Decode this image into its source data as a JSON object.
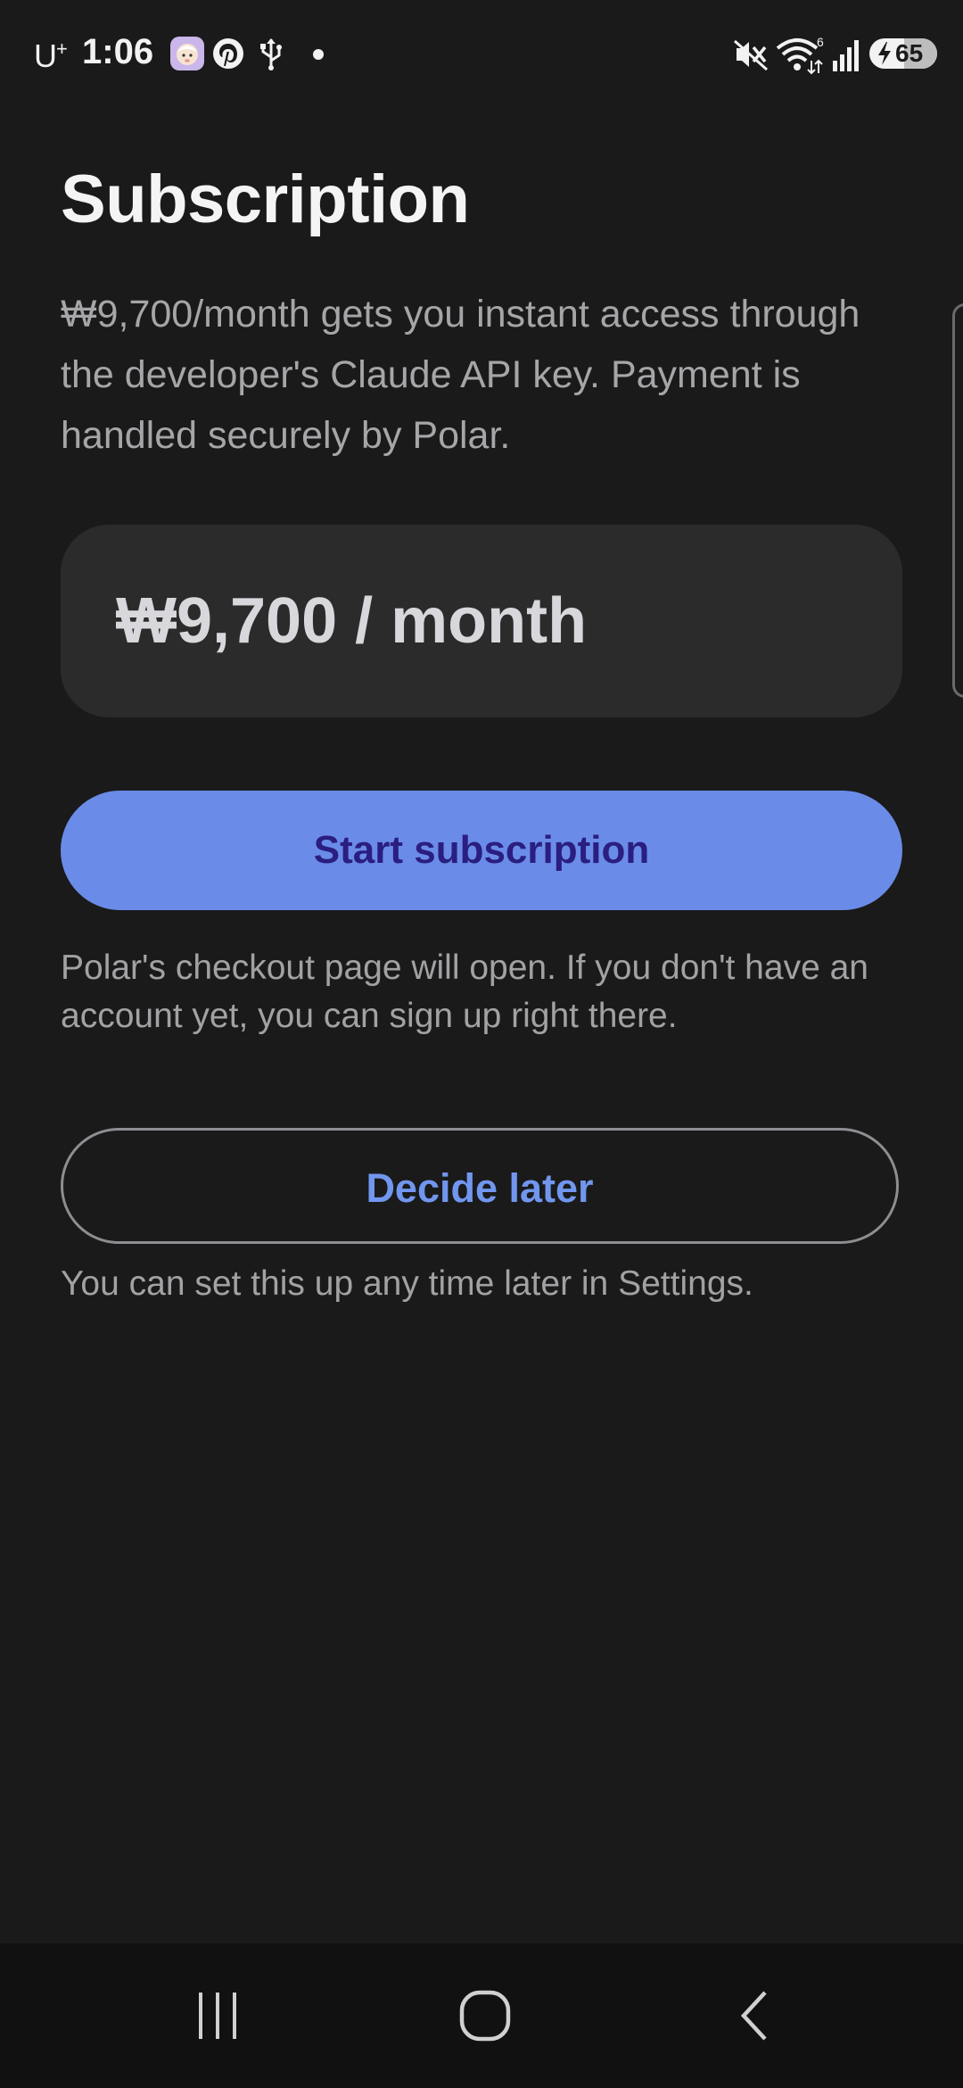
{
  "status_bar": {
    "carrier": "U",
    "carrier_sup": "+",
    "time": "1:06",
    "battery_level": "65",
    "wifi_band": "6"
  },
  "main": {
    "title": "Subscription",
    "description": "₩9,700/month gets you instant access through the developer's Claude API key. Payment is handled securely by Polar.",
    "price": "₩9,700 / month",
    "start_button_label": "Start subscription",
    "checkout_note": "Polar's checkout page will open. If you don't have an account yet, you can sign up right there.",
    "later_button_label": "Decide later",
    "settings_note": "You can set this up any time later in Settings."
  },
  "colors": {
    "background": "#1a1a1b",
    "card": "#2b2b2c",
    "primary": "#6a8ce8",
    "primary_text": "#2a1e80",
    "outline_text": "#7196ee"
  },
  "icons": {
    "status_left": [
      "baby-face-app-icon",
      "pinterest-icon",
      "usb-icon",
      "dot-icon"
    ],
    "status_right": [
      "mute-vibrate-icon",
      "wifi-icon",
      "signal-icon",
      "battery-icon"
    ],
    "nav": [
      "recents-icon",
      "home-icon",
      "back-icon"
    ]
  }
}
